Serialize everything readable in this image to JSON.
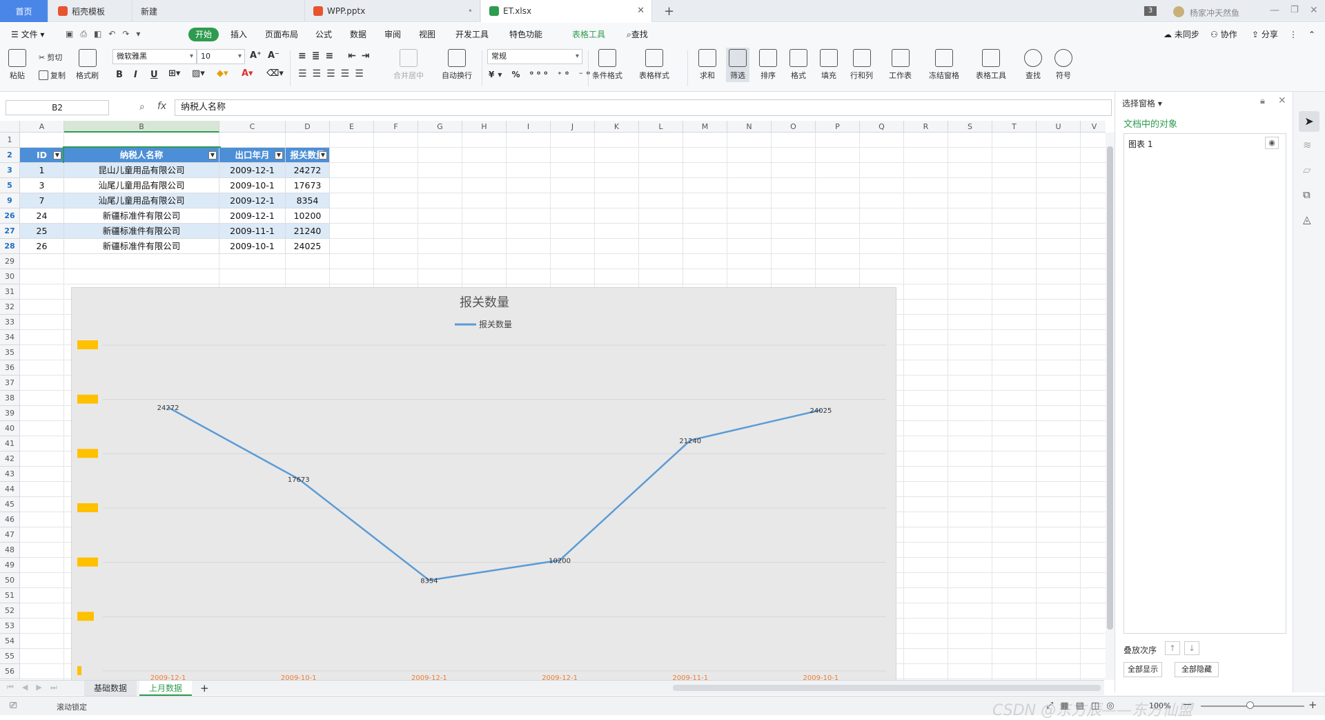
{
  "tabs": {
    "home": "首页",
    "items": [
      {
        "label": "稻壳模板",
        "color": "#e8542f"
      },
      {
        "label": "新建",
        "color": ""
      },
      {
        "label": "WPP.pptx",
        "color": "#e8542f"
      },
      {
        "label": "ET.xlsx",
        "color": "#2e9b4f"
      }
    ],
    "new_tab": "+",
    "badge": "3",
    "user": "杨家冲天然鱼"
  },
  "menu": {
    "file": "文件",
    "tabs": [
      "开始",
      "插入",
      "页面布局",
      "公式",
      "数据",
      "审阅",
      "视图",
      "开发工具",
      "特色功能",
      "表格工具"
    ],
    "search": "查找",
    "right": [
      "未同步",
      "协作",
      "分享"
    ]
  },
  "ribbon": {
    "paste": "粘贴",
    "cut": "剪切",
    "copy": "复制",
    "format_painter": "格式刷",
    "font_name": "微软雅黑",
    "font_size": "10",
    "merge": "合并居中",
    "wrap": "自动换行",
    "number_format": "常规",
    "buttons": [
      "条件格式",
      "表格样式",
      "求和",
      "筛选",
      "排序",
      "格式",
      "填充",
      "行和列",
      "工作表",
      "冻结窗格",
      "表格工具",
      "查找",
      "符号"
    ]
  },
  "formula": {
    "cell_ref": "B2",
    "fx": "fx",
    "value": "纳税人名称"
  },
  "grid": {
    "columns": [
      "A",
      "B",
      "C",
      "D",
      "E",
      "F",
      "G",
      "H",
      "I",
      "J",
      "K",
      "L",
      "M",
      "N",
      "O",
      "P",
      "Q",
      "R",
      "S",
      "T",
      "U",
      "V"
    ],
    "rows": [
      "1",
      "2",
      "3",
      "5",
      "9",
      "26",
      "27",
      "28",
      "29",
      "30",
      "31",
      "32",
      "33",
      "34",
      "35",
      "36",
      "37",
      "38",
      "39",
      "40",
      "41",
      "42",
      "43",
      "44",
      "45",
      "46",
      "47",
      "48",
      "49",
      "50",
      "51",
      "52",
      "53",
      "54",
      "55",
      "56"
    ],
    "table_header": [
      "ID",
      "纳税人名称",
      "出口年月",
      "报关数量"
    ],
    "table_rows": [
      [
        "1",
        "昆山儿童用品有限公司",
        "2009-12-1",
        "24272"
      ],
      [
        "3",
        "汕尾儿童用品有限公司",
        "2009-10-1",
        "17673"
      ],
      [
        "7",
        "汕尾儿童用品有限公司",
        "2009-12-1",
        "8354"
      ],
      [
        "24",
        "新疆标准件有限公司",
        "2009-12-1",
        "10200"
      ],
      [
        "25",
        "新疆标准件有限公司",
        "2009-11-1",
        "21240"
      ],
      [
        "26",
        "新疆标准件有限公司",
        "2009-10-1",
        "24025"
      ]
    ]
  },
  "chart_data": {
    "type": "line",
    "title": "报关数量",
    "series": [
      {
        "name": "报关数量",
        "values": [
          24272,
          17673,
          8354,
          10200,
          21240,
          24025
        ]
      }
    ],
    "categories": [
      "2009-12-1",
      "2009-10-1",
      "2009-12-1",
      "2009-12-1",
      "2009-11-1",
      "2009-10-1"
    ],
    "data_labels": [
      "24272",
      "17673",
      "8354",
      "10200",
      "21240",
      "24025"
    ],
    "ylim": [
      0,
      30000
    ],
    "line_color": "#5b9bd5",
    "legend": "top-center",
    "grid": true
  },
  "side_panel": {
    "title": "选择窗格",
    "subtitle": "文档中的对象",
    "object": "图表 1",
    "order_label": "叠放次序",
    "show_all": "全部显示",
    "hide_all": "全部隐藏"
  },
  "sheets": {
    "items": [
      "基础数据",
      "上月数据"
    ],
    "add": "+"
  },
  "status": {
    "left": "滚动锁定",
    "zoom": "100%",
    "watermark": "CSDN @东方辰——东方仙盟"
  }
}
